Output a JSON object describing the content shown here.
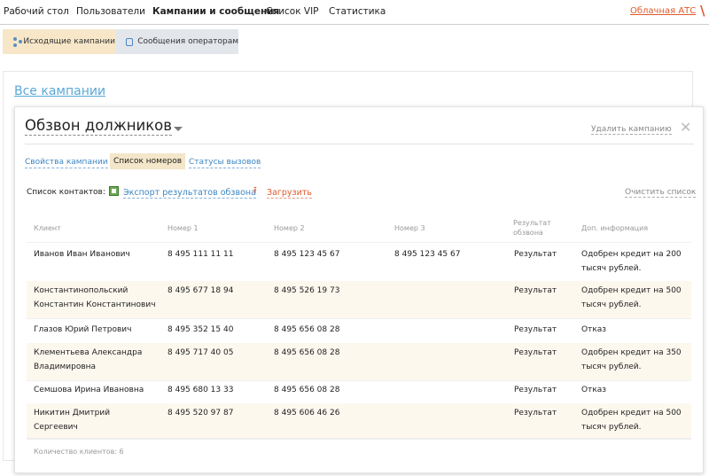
{
  "nav": {
    "items": [
      "Рабочий стол",
      "Пользователи",
      "Кампании и сообщения",
      "Список VIP",
      "Статистика"
    ],
    "cloud_pbx": "Облачная АТС",
    "last_mark": "\\"
  },
  "subtabs": {
    "outgoing": "Исходящие кампании",
    "operators": "Сообщения операторам"
  },
  "all_campaigns": "Все кампании",
  "campaign": {
    "title": "Обзвон должников",
    "delete": "Удалить кампанию",
    "close": "✕",
    "tabs": [
      "Свойства кампании",
      "Список номеров",
      "Статусы вызовов"
    ]
  },
  "contacts": {
    "label": "Список контактов:",
    "export": "Экспорт результатов обзвона",
    "upload": "Загрузить",
    "clear": "Очистить список"
  },
  "table": {
    "headers": [
      "Клиент",
      "Номер 1",
      "Номер 2",
      "Номер 3",
      "Результат обзвона",
      "Доп. информация"
    ],
    "header_result_lines": [
      "Результат",
      "обзвона"
    ],
    "rows": [
      {
        "client": [
          "Иванов Иван Иванович"
        ],
        "n1": "8 495 111 11 11",
        "n2": "8 495 123 45 67",
        "n3": "8 495 123 45 67",
        "result": "Результат",
        "info": [
          "Одобрен кредит на 200",
          "тысяч рублей."
        ]
      },
      {
        "client": [
          "Константинопольский",
          "Константин Константинович"
        ],
        "n1": "8 495 677 18 94",
        "n2": "8 495 526 19 73",
        "n3": "",
        "result": "Результат",
        "info": [
          "Одобрен кредит на 500",
          "тысяч рублей."
        ]
      },
      {
        "client": [
          "Глазов Юрий Петрович"
        ],
        "n1": "8 495 352 15 40",
        "n2": "8 495 656 08 28",
        "n3": "",
        "result": "Результат",
        "info": [
          "Отказ"
        ]
      },
      {
        "client": [
          "Клементьева Александра",
          "Владимировна"
        ],
        "n1": "8 495 717 40 05",
        "n2": "8 495 656 08 28",
        "n3": "",
        "result": "Результат",
        "info": [
          "Одобрен кредит на 350",
          "тысяч рублей."
        ]
      },
      {
        "client": [
          "Семшова Ирина Ивановна"
        ],
        "n1": "8 495 680 13 33",
        "n2": "8 495 656 08 28",
        "n3": "",
        "result": "Результат",
        "info": [
          "Отказ"
        ]
      },
      {
        "client": [
          "Никитин Дмитрий",
          "Сергеевич"
        ],
        "n1": "8 495 520 97 87",
        "n2": "8 495 606 46 26",
        "n3": "",
        "result": "Результат",
        "info": [
          "Одобрен кредит на 500",
          "тысяч рублей."
        ]
      }
    ],
    "count_label": "Количество клиентов: 6"
  }
}
